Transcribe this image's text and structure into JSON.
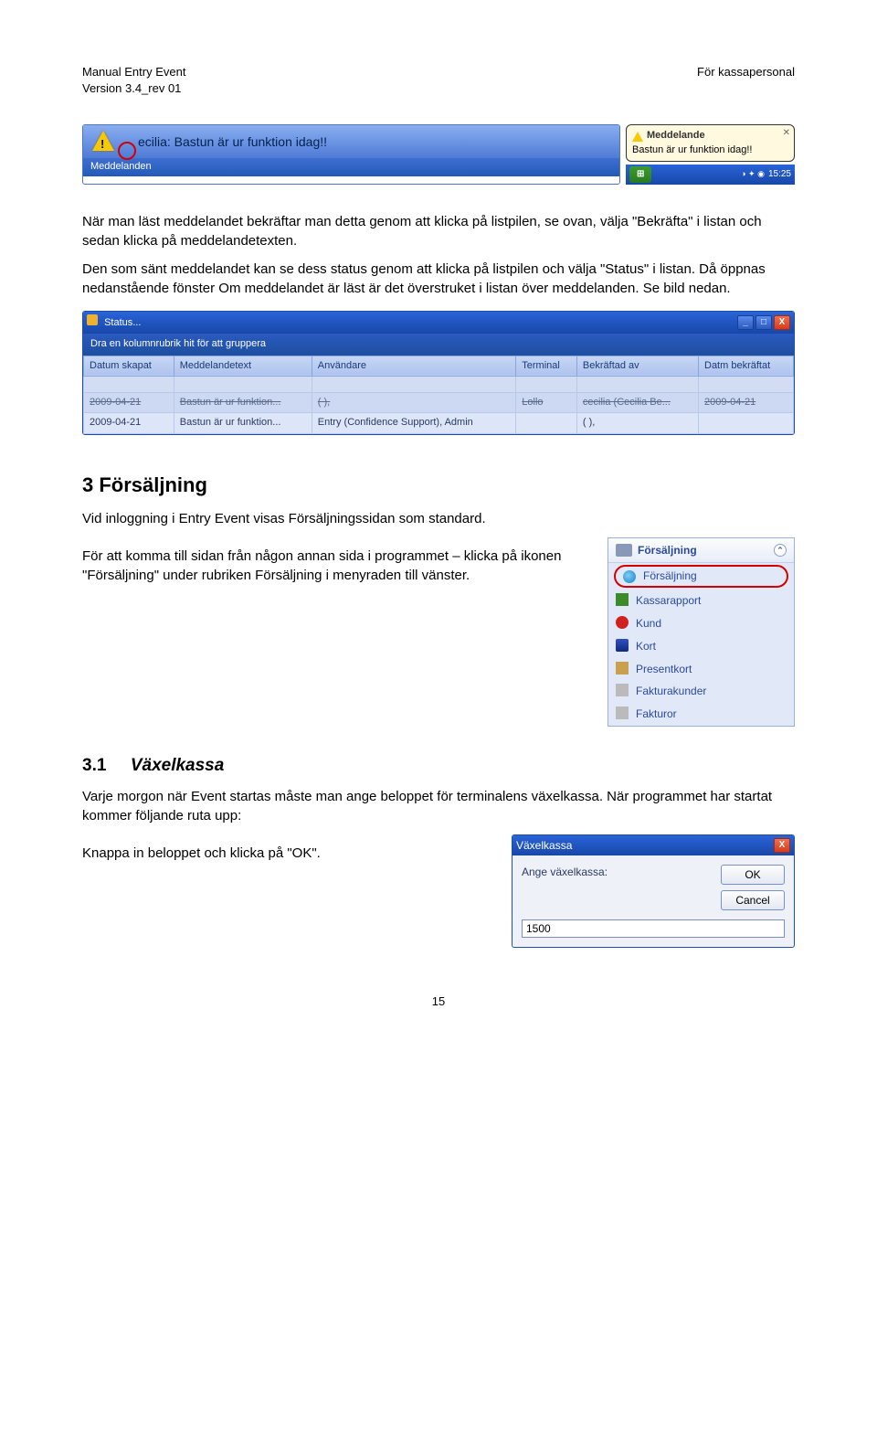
{
  "header": {
    "left1": "Manual Entry Event",
    "left2": "Version 3.4_rev 01",
    "right": "För kassapersonal"
  },
  "msgbar": {
    "label": "Meddelanden",
    "text": "ecilia: Bastun är ur funktion idag!!"
  },
  "balloon": {
    "title": "Meddelande",
    "body": "Bastun är ur funktion idag!!"
  },
  "taskbar": {
    "time": "15:25"
  },
  "para1": "När man läst meddelandet bekräftar man detta genom att klicka på listpilen, se ovan, välja \"Bekräfta\" i listan och sedan klicka på meddelandetexten.",
  "para2": "Den som sänt meddelandet kan se dess status genom att klicka på listpilen och välja \"Status\" i listan. Då öppnas nedanstående fönster Om meddelandet är läst är det överstruket i listan över meddelanden. Se bild nedan.",
  "statuswin": {
    "title": "Status...",
    "grouphint": "Dra en kolumnrubrik hit för att gruppera",
    "cols": [
      "Datum skapat",
      "Meddelandetext",
      "Användare",
      "Terminal",
      "Bekräftad av",
      "Datm bekräftat"
    ],
    "rows": [
      {
        "strike": true,
        "cells": [
          "2009-04-21",
          "Bastun är ur funktion...",
          "( ),",
          "Lollo",
          "cecilia (Cecilia Be...",
          "2009-04-21"
        ]
      },
      {
        "strike": false,
        "cells": [
          "2009-04-21",
          "Bastun är ur funktion...",
          "Entry (Confidence Support), Admin",
          "",
          "( ),",
          ""
        ]
      }
    ],
    "btn_min": "_",
    "btn_max": "□",
    "btn_close": "X"
  },
  "section3": {
    "heading": "3   Försäljning",
    "intro": "Vid inloggning i Entry Event visas Försäljningssidan som standard.",
    "para": "För att komma till sidan från någon annan sida i programmet – klicka på ikonen \"Försäljning\" under rubriken Försäljning i menyraden till vänster."
  },
  "sidepanel": {
    "header": "Försäljning",
    "items": [
      "Försäljning",
      "Kassarapport",
      "Kund",
      "Kort",
      "Presentkort",
      "Fakturakunder",
      "Fakturor"
    ]
  },
  "section31": {
    "heading_num": "3.1",
    "heading_txt": "Växelkassa",
    "para": "Varje morgon när Event startas måste man ange beloppet för terminalens växelkassa. När programmet har startat kommer följande ruta upp:",
    "instr": "Knappa in beloppet och klicka på \"OK\"."
  },
  "vkdialog": {
    "title": "Växelkassa",
    "label": "Ange växelkassa:",
    "ok": "OK",
    "cancel": "Cancel",
    "value": "1500"
  },
  "pagenum": "15"
}
